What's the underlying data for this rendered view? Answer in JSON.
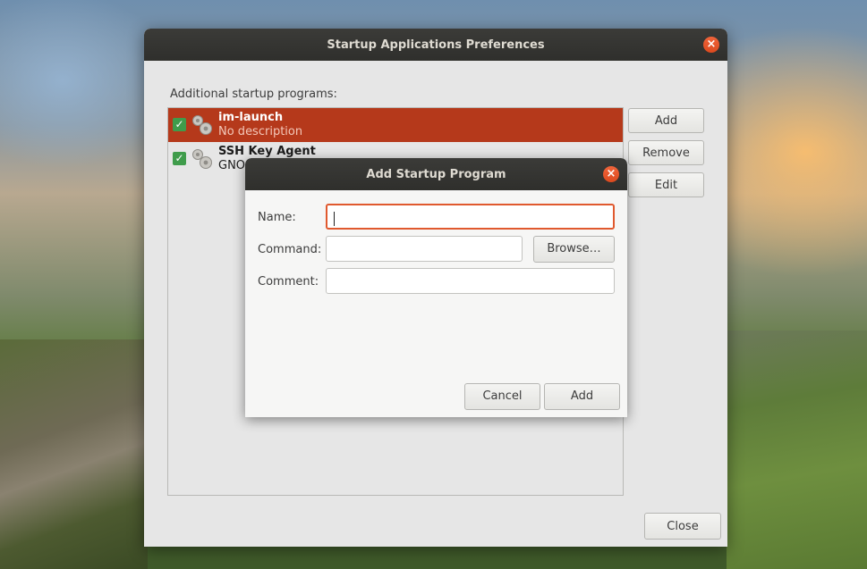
{
  "main_window": {
    "title": "Startup Applications Preferences",
    "close_icon": "close-icon",
    "section_label": "Additional startup programs:",
    "programs": [
      {
        "name": "im-launch",
        "description": "No description",
        "enabled": true,
        "selected": true,
        "icon": "gear-icon"
      },
      {
        "name": "SSH Key Agent",
        "description": "GNO",
        "enabled": true,
        "selected": false,
        "icon": "gear-icon"
      }
    ],
    "buttons": {
      "add": "Add",
      "remove": "Remove",
      "edit": "Edit",
      "close": "Close"
    }
  },
  "dialog": {
    "title": "Add Startup Program",
    "close_icon": "close-icon",
    "fields": {
      "name_label": "Name:",
      "name_value": "",
      "command_label": "Command:",
      "command_value": "",
      "comment_label": "Comment:",
      "comment_value": ""
    },
    "buttons": {
      "browse": "Browse…",
      "cancel": "Cancel",
      "add": "Add"
    }
  },
  "colors": {
    "accent": "#e0592e",
    "selection": "#b5391b",
    "titlebar": "#333330",
    "checkbox": "#3f9c4b"
  }
}
